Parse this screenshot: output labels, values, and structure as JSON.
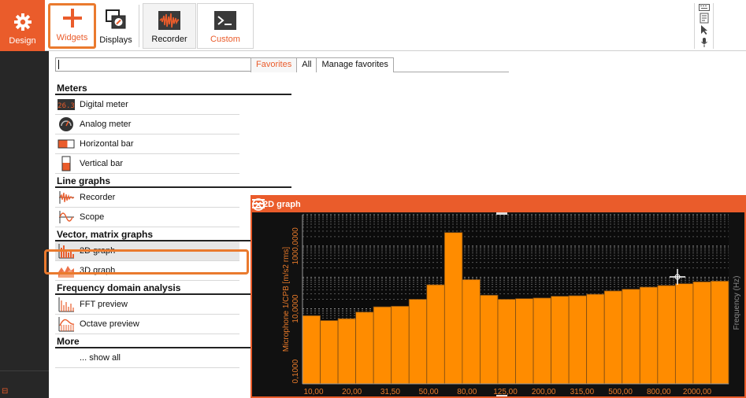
{
  "toolbar": {
    "design": "Design",
    "widgets": "Widgets",
    "displays": "Displays",
    "recorder": "Recorder",
    "custom": "Custom"
  },
  "search": {
    "value": "",
    "placeholder": ""
  },
  "categories": [
    {
      "title": "Meters",
      "items": [
        {
          "label": "Digital meter",
          "icon": "digital-meter-icon"
        },
        {
          "label": "Analog meter",
          "icon": "analog-meter-icon"
        },
        {
          "label": "Horizontal bar",
          "icon": "horizontal-bar-icon"
        },
        {
          "label": "Vertical bar",
          "icon": "vertical-bar-icon"
        }
      ]
    },
    {
      "title": "Line graphs",
      "items": [
        {
          "label": "Recorder",
          "icon": "recorder-graph-icon"
        },
        {
          "label": "Scope",
          "icon": "scope-icon"
        }
      ]
    },
    {
      "title": "Vector, matrix graphs",
      "items": [
        {
          "label": "2D graph",
          "icon": "2d-graph-icon",
          "selected": true
        },
        {
          "label": "3D graph",
          "icon": "3d-graph-icon"
        }
      ]
    },
    {
      "title": "Frequency domain analysis",
      "items": [
        {
          "label": "FFT preview",
          "icon": "fft-preview-icon"
        },
        {
          "label": "Octave preview",
          "icon": "octave-preview-icon"
        }
      ]
    },
    {
      "title": "More",
      "items": [
        {
          "label": "... show all",
          "icon": ""
        }
      ]
    }
  ],
  "tabs": [
    {
      "label": "Favorites",
      "active": true
    },
    {
      "label": "All",
      "active": false
    },
    {
      "label": "Manage favorites",
      "active": false
    }
  ],
  "graph_widget": {
    "title": "2D graph",
    "accent": "#ea5c2b",
    "bar_color": "#ff8c00"
  },
  "chart_data": {
    "type": "bar",
    "ylabel": "Microphone 1/CPB [m/s2 rms]",
    "xlabel": "Frequency (Hz)",
    "yscale": "log",
    "ylim": [
      0.04,
      10000
    ],
    "yticks": [
      "0,1000",
      "10,0000",
      "1000,0000"
    ],
    "xticks": [
      "10,00",
      "20,00",
      "31,50",
      "50,00",
      "80,00",
      "125,00",
      "200,00",
      "315,00",
      "500,00",
      "800,00",
      "2000,00"
    ],
    "values": [
      6.0,
      4.2,
      4.8,
      7.8,
      11.5,
      12.0,
      20.0,
      58.0,
      2700.0,
      85.0,
      27.0,
      20.0,
      21.0,
      22.0,
      25.0,
      26.0,
      29.0,
      37.0,
      42.0,
      49.0,
      55.0,
      63.0,
      72.0,
      76.0
    ]
  }
}
